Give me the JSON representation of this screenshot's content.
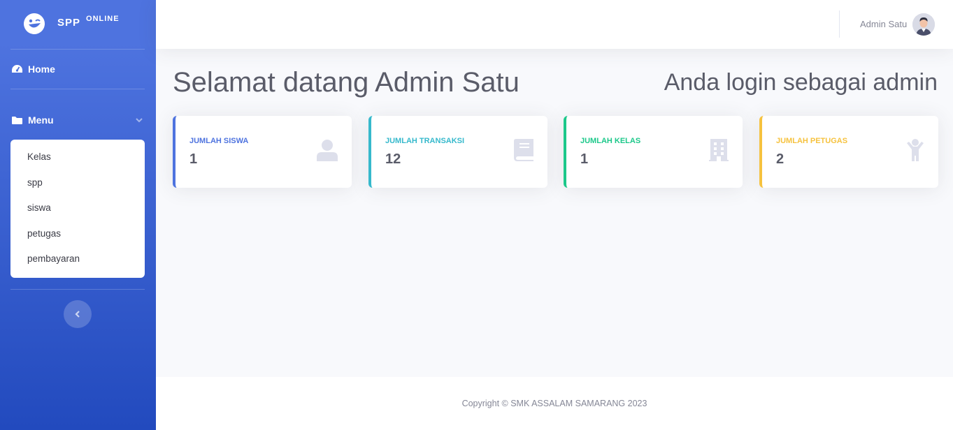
{
  "brand": {
    "name": "SPP",
    "suffix": "ONLINE"
  },
  "sidebar": {
    "home_label": "Home",
    "menu_label": "Menu",
    "submenu": [
      "Kelas",
      "spp",
      "siswa",
      "petugas",
      "pembayaran"
    ]
  },
  "topbar": {
    "user_name": "Admin Satu"
  },
  "main": {
    "welcome": "Selamat datang Admin Satu",
    "role": "Anda login sebagai admin"
  },
  "cards": [
    {
      "label": "JUMLAH SISWA",
      "value": "1",
      "color": "#4e73df",
      "icon": "user-icon"
    },
    {
      "label": "JUMLAH TRANSAKSI",
      "value": "12",
      "color": "#36b9cc",
      "icon": "book-icon"
    },
    {
      "label": "JUMLAH KELAS",
      "value": "1",
      "color": "#1cc88a",
      "icon": "building-icon"
    },
    {
      "label": "JUMLAH PETUGAS",
      "value": "2",
      "color": "#f6c23e",
      "icon": "child-icon"
    }
  ],
  "footer": {
    "copyright": "Copyright © SMK ASSALAM SAMARANG 2023"
  }
}
